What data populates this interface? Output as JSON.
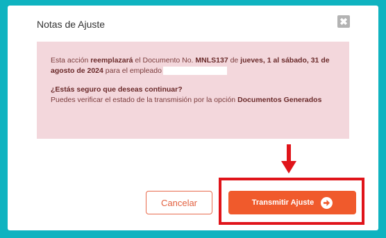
{
  "modal": {
    "title": "Notas de Ajuste",
    "close_glyph": "✖",
    "close_icon": "close-icon"
  },
  "alert": {
    "line1_pre": "Esta acción ",
    "line1_b1": "reemplazará",
    "line1_mid1": " el Documento No. ",
    "line1_b2": "MNLS137",
    "line1_mid2": " de ",
    "line1_b3": "jueves, 1 al sábado, 31 de agosto de 2024",
    "line1_post": " para el empleado",
    "question": "¿Estás seguro que deseas continuar?",
    "hint_pre": "Puedes verificar el estado de la transmisión por la opción ",
    "hint_b": "Documentos Generados",
    "bg_color": "#f3d7dc"
  },
  "actions": {
    "cancel_label": "Cancelar",
    "transmit_label": "Transmitir Ajuste",
    "transmit_icon": "arrow-right-circle-icon",
    "accent_color": "#f05a2c"
  },
  "annotation": {
    "arrow_icon": "arrow-down-icon",
    "highlight_color": "#e0141a"
  }
}
